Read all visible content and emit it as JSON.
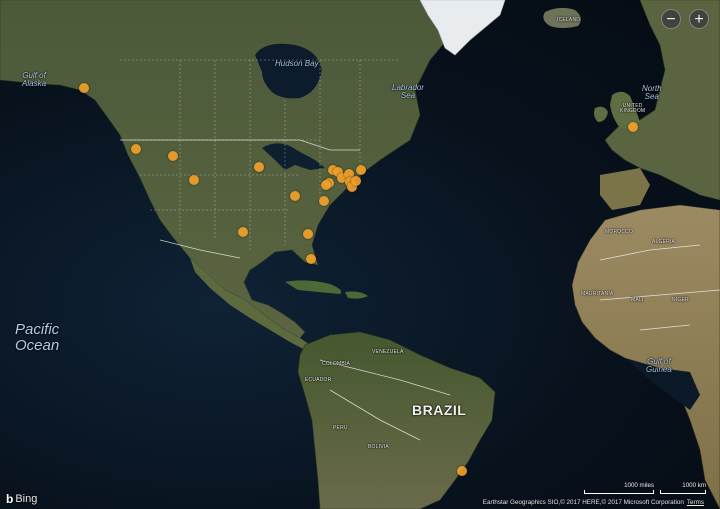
{
  "controls": {
    "zoom_out_label": "−",
    "zoom_in_label": "+"
  },
  "labels": {
    "gulf_of_alaska": "Gulf of\nAlaska",
    "hudson_bay": "Hudson Bay",
    "labrador_sea": "Labrador\nSea",
    "north_sea": "North\nSea",
    "iceland": "ICELAND",
    "united_kingdom": "UNITED\nKINGDOM",
    "pacific_ocean": "Pacific\nOcean",
    "brazil": "BRAZIL",
    "gulf_of_guinea": "Gulf of\nGuinea",
    "morocco": "MOROCCO",
    "algeria": "ALGERIA",
    "mauritania": "MAURITANIA",
    "mali": "MALI",
    "niger": "NIGER",
    "ecuador": "ECUADOR",
    "peru": "PERU",
    "bolivia": "BOLIVIA",
    "venezuela": "VENEZUELA",
    "colombia": "COLOMBIA"
  },
  "footer": {
    "brand": "Bing",
    "copyright": "Earthstar Geographics SIO,© 2017 HERE,© 2017 Microsoft Corporation",
    "terms": "Terms",
    "scale_miles": "1000 miles",
    "scale_km": "1000 km"
  },
  "markers": {
    "color": "#f0a02a",
    "count": 22
  }
}
